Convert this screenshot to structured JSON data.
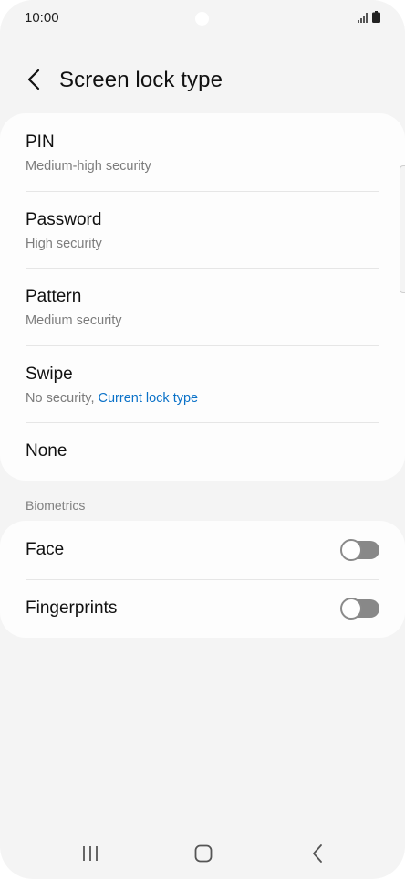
{
  "status_bar": {
    "time": "10:00",
    "icons": [
      "signal-icon",
      "battery-icon"
    ]
  },
  "header": {
    "back_icon": "back-arrow-icon",
    "title": "Screen lock type"
  },
  "lock_types": [
    {
      "title": "PIN",
      "subtitle": "Medium-high security"
    },
    {
      "title": "Password",
      "subtitle": "High security"
    },
    {
      "title": "Pattern",
      "subtitle": "Medium security"
    },
    {
      "title": "Swipe",
      "subtitle_prefix": "No security, ",
      "subtitle_highlight": "Current lock type"
    },
    {
      "title": "None"
    }
  ],
  "biometrics": {
    "section_label": "Biometrics",
    "items": [
      {
        "title": "Face",
        "enabled": false
      },
      {
        "title": "Fingerprints",
        "enabled": false
      }
    ]
  },
  "nav_bar": {
    "icons": [
      "recent-apps-icon",
      "home-icon",
      "back-icon"
    ]
  },
  "colors": {
    "background": "#f4f4f4",
    "card": "#fdfdfd",
    "accent": "#0b72c8",
    "toggle_off": "#888888"
  }
}
